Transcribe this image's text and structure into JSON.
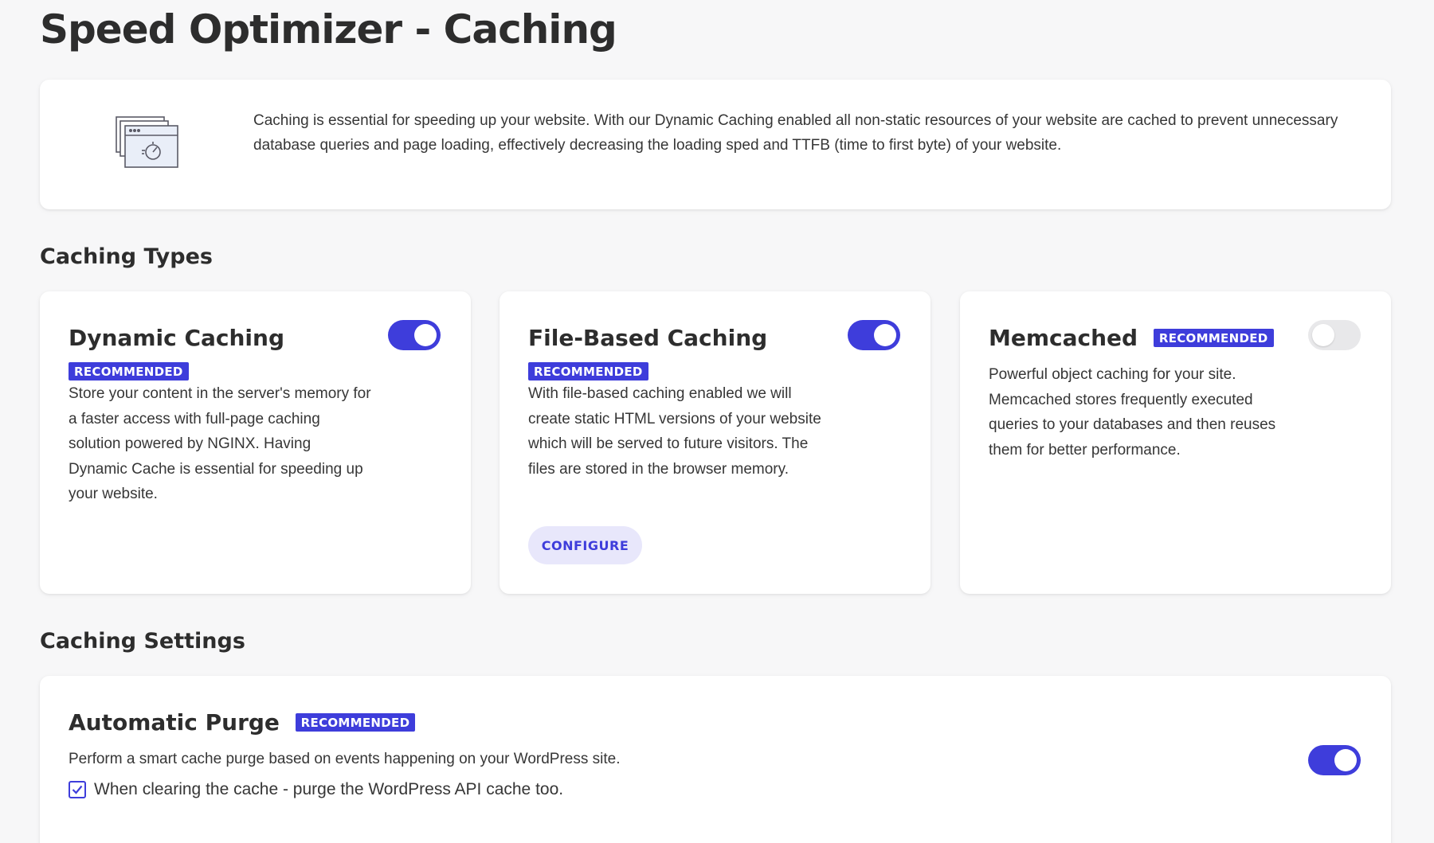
{
  "page": {
    "title": "Speed Optimizer - Caching"
  },
  "intro": {
    "icon": "browser-speed-icon",
    "text": "Caching is essential for speeding up your website. With our Dynamic Caching enabled all non-static resources of your website are cached to prevent unnecessary database queries and page loading, effectively decreasing the loading sped and TTFB (time to first byte) of your website."
  },
  "caching_types": {
    "heading": "Caching Types",
    "cards": [
      {
        "title": "Dynamic Caching",
        "badge": "RECOMMENDED",
        "enabled": true,
        "description": "Store your content in the server's memory for a faster access with full-page caching solution powered by NGINX. Having Dynamic Cache is essential for speeding up your website."
      },
      {
        "title": "File-Based Caching",
        "badge": "RECOMMENDED",
        "enabled": true,
        "description": "With file-based caching enabled we will create static HTML versions of your website which will be served to future visitors. The files are stored in the browser memory.",
        "button_label": "CONFIGURE"
      },
      {
        "title": "Memcached",
        "badge": "RECOMMENDED",
        "enabled": false,
        "description": "Powerful object caching for your site. Memcached stores frequently executed queries to your databases and then reuses them for better performance."
      }
    ]
  },
  "caching_settings": {
    "heading": "Caching Settings",
    "automatic_purge": {
      "title": "Automatic Purge",
      "badge": "RECOMMENDED",
      "enabled": true,
      "description": "Perform a smart cache purge based on events happening on your WordPress site.",
      "checkbox_label": "When clearing the cache - purge the WordPress API cache too.",
      "checkbox_checked": true
    }
  },
  "colors": {
    "accent": "#3e3ddb",
    "accent_light": "#e8e7fb",
    "toggle_off": "#e8e8ea",
    "background": "#f7f7f8",
    "card": "#ffffff"
  }
}
